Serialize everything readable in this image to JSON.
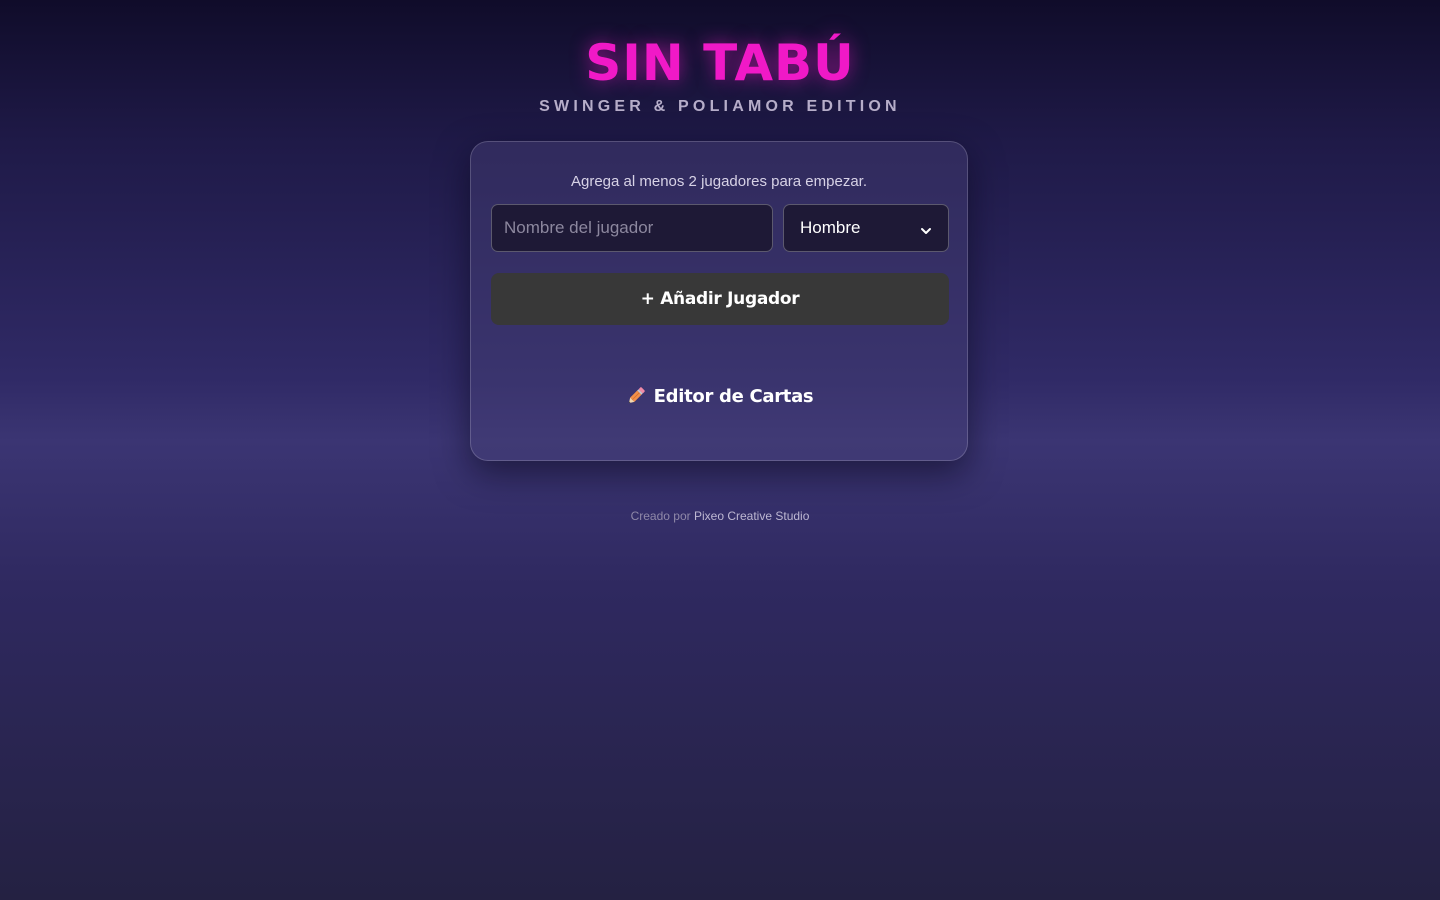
{
  "header": {
    "title": "SIN TABÚ",
    "subtitle": "SWINGER & POLIAMOR EDITION"
  },
  "setup": {
    "instructions": "Agrega al menos 2 jugadores para empezar.",
    "name_input": {
      "placeholder": "Nombre del jugador",
      "value": ""
    },
    "gender_select": {
      "selected": "Hombre",
      "icon": "chevron-down-icon"
    },
    "add_button_label": "+ Añadir Jugador",
    "editor_link": {
      "label": "Editor de Cartas",
      "icon": "pencil-icon"
    }
  },
  "footer": {
    "prefix": "Creado por",
    "studio": "Pixeo Creative Studio"
  },
  "colors": {
    "title_accent": "#f019c7",
    "button_bg": "#383838",
    "background_top": "#100c2a",
    "background_mid": "#3b3573",
    "background_bottom": "#242142"
  }
}
